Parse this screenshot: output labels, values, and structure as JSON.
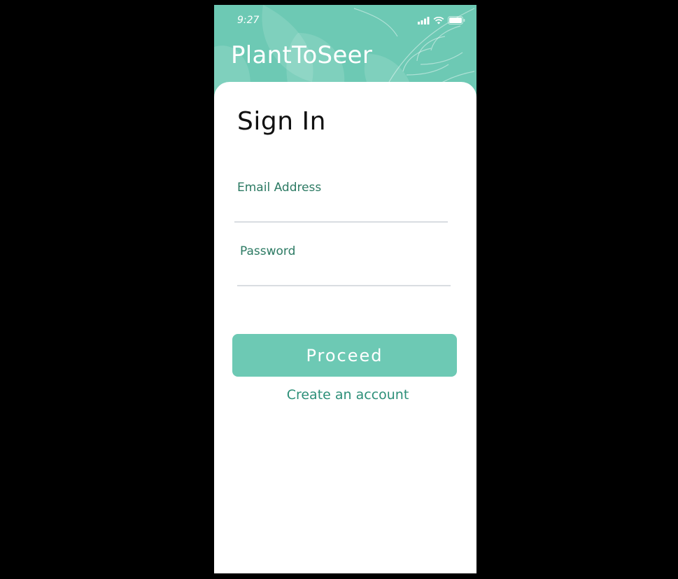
{
  "status_bar": {
    "time": "9:27",
    "icons": [
      "cellular-signal-icon",
      "wifi-icon",
      "battery-icon"
    ]
  },
  "header": {
    "app_title": "PlantToSeer"
  },
  "form": {
    "title": "Sign In",
    "email_label": "Email Address",
    "email_value": "",
    "password_label": "Password",
    "password_value": "",
    "proceed_label": "Proceed",
    "create_account_label": "Create an account"
  },
  "colors": {
    "accent": "#6dc9b4",
    "label_text": "#2c7a63",
    "link_text": "#2c8f78",
    "divider": "#d9dde1"
  }
}
